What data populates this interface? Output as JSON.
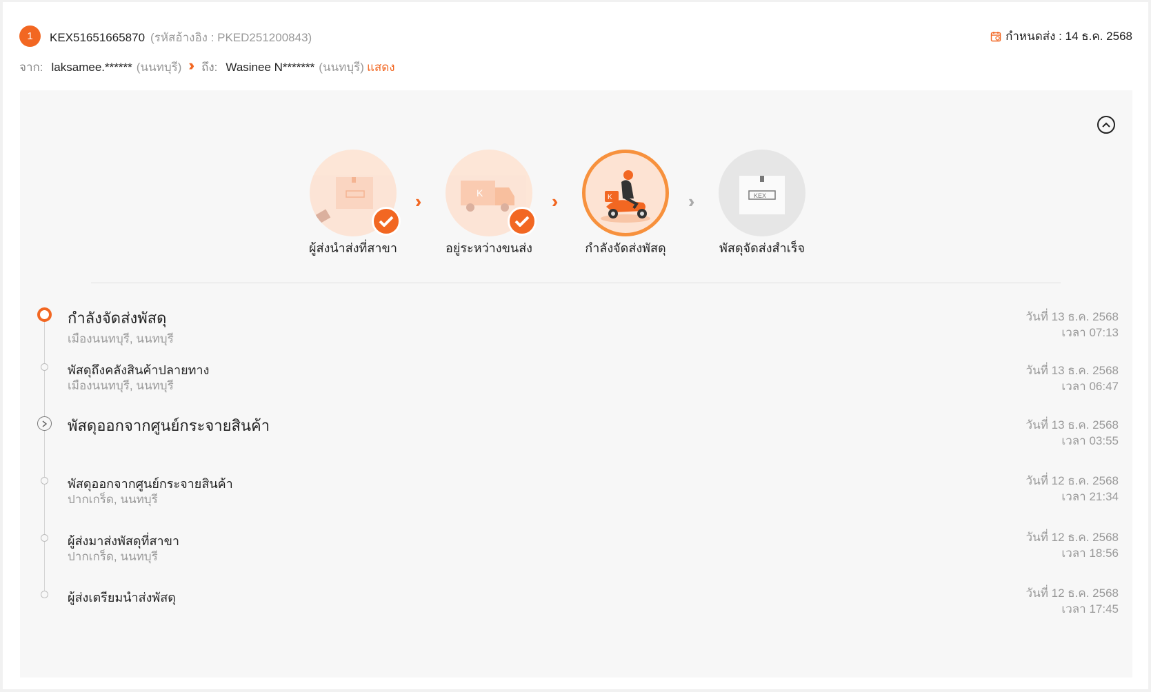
{
  "header": {
    "index": "1",
    "tracking_no": "KEX51651665870",
    "reference": "(รหัสอ้างอิง : PKED251200843)",
    "due_label": "กำหนดส่ง : 14 ธ.ค. 2568"
  },
  "route": {
    "from_label": "จาก:",
    "from_name": "laksamee.******",
    "from_city": "(นนทบุรี)",
    "to_label": "ถึง:",
    "to_name": "Wasinee N*******",
    "to_city": "(นนทบุรี)",
    "show_link": "แสดง"
  },
  "steps": [
    {
      "label": "ผู้ส่งนำส่งที่สาขา",
      "status": "done",
      "icon": "parcel-box-icon"
    },
    {
      "label": "อยู่ระหว่างขนส่ง",
      "status": "done",
      "icon": "truck-icon"
    },
    {
      "label": "กำลังจัดส่งพัสดุ",
      "status": "active",
      "icon": "scooter-courier-icon"
    },
    {
      "label": "พัสดุจัดส่งสำเร็จ",
      "status": "pending",
      "icon": "delivered-box-icon"
    }
  ],
  "timeline": [
    {
      "title": "กำลังจัดส่งพัสดุ",
      "location": "เมืองนนทบุรี, นนทบุรี",
      "date": "วันที่ 13 ธ.ค. 2568",
      "time": "เวลา 07:13"
    },
    {
      "title": "พัสดุถึงคลังสินค้าปลายทาง",
      "location": "เมืองนนทบุรี, นนทบุรี",
      "date": "วันที่ 13 ธ.ค. 2568",
      "time": "เวลา 06:47"
    },
    {
      "title": "พัสดุออกจากศูนย์กระจายสินค้า",
      "location": "",
      "date": "วันที่ 13 ธ.ค. 2568",
      "time": "เวลา 03:55"
    },
    {
      "title": "พัสดุออกจากศูนย์กระจายสินค้า",
      "location": "ปากเกร็ด, นนทบุรี",
      "date": "วันที่ 12 ธ.ค. 2568",
      "time": "เวลา 21:34"
    },
    {
      "title": "ผู้ส่งมาส่งพัสดุที่สาขา",
      "location": "ปากเกร็ด, นนทบุรี",
      "date": "วันที่ 12 ธ.ค. 2568",
      "time": "เวลา 18:56"
    },
    {
      "title": "ผู้ส่งเตรียมนำส่งพัสดุ",
      "location": "",
      "date": "วันที่ 12 ธ.ค. 2568",
      "time": "เวลา 17:45"
    }
  ],
  "colors": {
    "accent": "#f26722",
    "accent_light": "#fde3d3",
    "panel_bg": "#f7f7f7"
  }
}
